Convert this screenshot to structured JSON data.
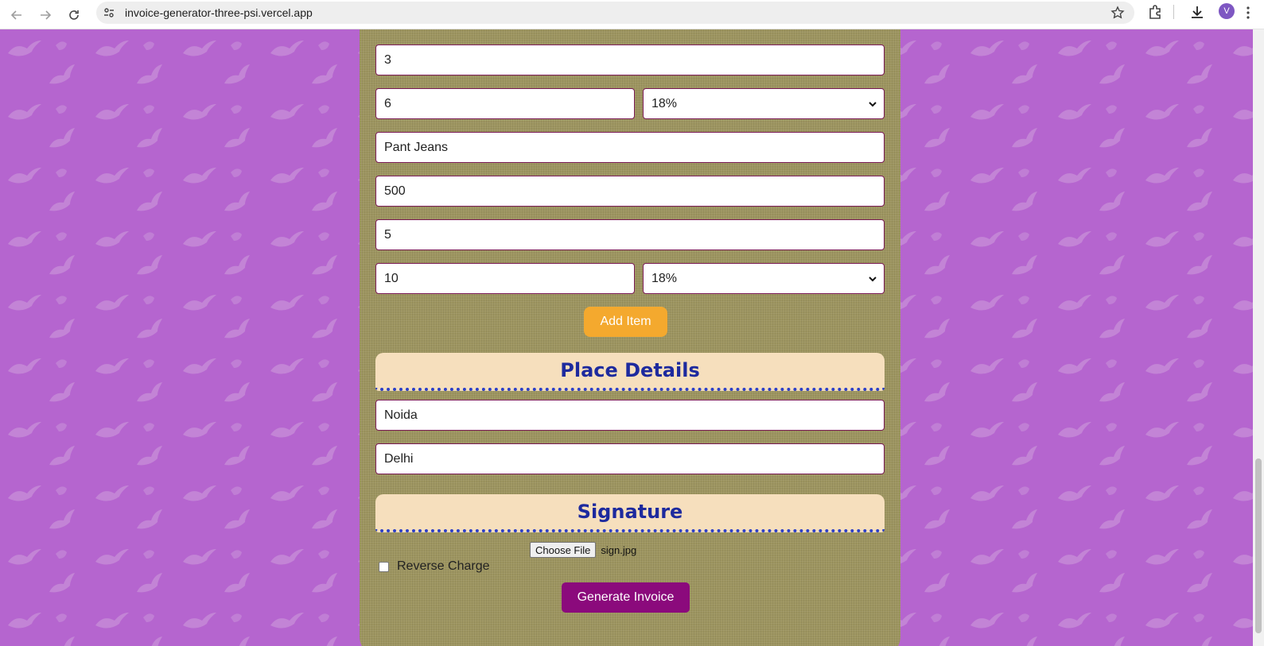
{
  "browser": {
    "url": "invoice-generator-three-psi.vercel.app",
    "profile_initial": "V"
  },
  "form": {
    "item1_quantity": "3",
    "item1_discount": "6",
    "item1_tax": "18%",
    "item2_description": "Pant Jeans",
    "item2_price": "500",
    "item2_quantity": "5",
    "item2_discount": "10",
    "item2_tax": "18%",
    "add_item_label": "Add Item",
    "place_details_title": "Place Details",
    "place_of_supply": "Noida",
    "place_of_delivery": "Delhi",
    "signature_title": "Signature",
    "choose_file_label": "Choose File",
    "file_name": "sign.jpg",
    "reverse_charge_label": "Reverse Charge",
    "generate_label": "Generate Invoice"
  },
  "colors": {
    "page_background": "#b565cf",
    "card_background": "#9d9560",
    "section_header": "#f6dfbd",
    "section_title": "#1d2a9e",
    "add_button": "#f4a92e",
    "generate_button": "#8b0a7c"
  }
}
